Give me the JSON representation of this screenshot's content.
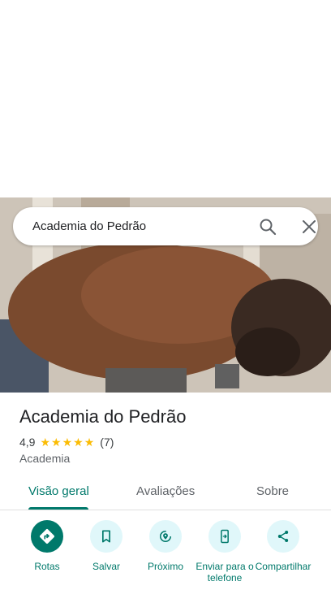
{
  "search": {
    "query": "Academia do Pedrão"
  },
  "place": {
    "title": "Academia do Pedrão",
    "rating": "4,9",
    "stars": 5,
    "review_count": "(7)",
    "category": "Academia"
  },
  "tabs": [
    {
      "label": "Visão geral",
      "active": true
    },
    {
      "label": "Avaliações",
      "active": false
    },
    {
      "label": "Sobre",
      "active": false
    }
  ],
  "actions": [
    {
      "label": "Rotas",
      "icon": "directions-icon"
    },
    {
      "label": "Salvar",
      "icon": "bookmark-icon"
    },
    {
      "label": "Próximo",
      "icon": "nearby-icon"
    },
    {
      "label": "Enviar para o telefone",
      "icon": "send-to-phone-icon"
    },
    {
      "label": "Compartilhar",
      "icon": "share-icon"
    }
  ],
  "colors": {
    "accent": "#00796b",
    "star": "#fbbc04",
    "action_bg": "#e0f7fa"
  }
}
